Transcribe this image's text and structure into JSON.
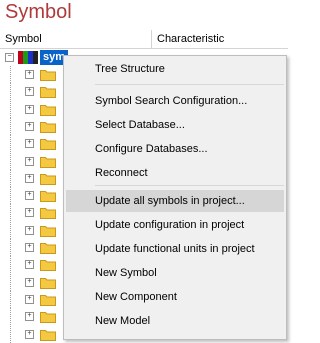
{
  "window": {
    "title": "Symbol"
  },
  "columns": {
    "symbol": "Symbol",
    "characteristic": "Characteristic"
  },
  "tree": {
    "root": {
      "label": "sym",
      "expander": "−",
      "icon": "rgb-symbol-library-icon"
    },
    "child_expander": "+",
    "child_icon": "folder-icon"
  },
  "context_menu": {
    "items": [
      {
        "label": "Tree Structure"
      },
      {
        "label": "Symbol Search Configuration..."
      },
      {
        "label": "Select Database..."
      },
      {
        "label": "Configure Databases..."
      },
      {
        "label": "Reconnect"
      },
      {
        "label": "Update all symbols in project...",
        "highlighted": true
      },
      {
        "label": "Update configuration in project"
      },
      {
        "label": "Update functional units in project"
      },
      {
        "label": "New Symbol"
      },
      {
        "label": "New Component"
      },
      {
        "label": "New Model"
      }
    ]
  },
  "colors": {
    "title_red": "#b03a3a",
    "selection_blue": "#0a63c8",
    "menu_background": "#f0f0f0",
    "menu_highlight": "#d6d6d6",
    "folder_yellow": "#f5c842"
  }
}
